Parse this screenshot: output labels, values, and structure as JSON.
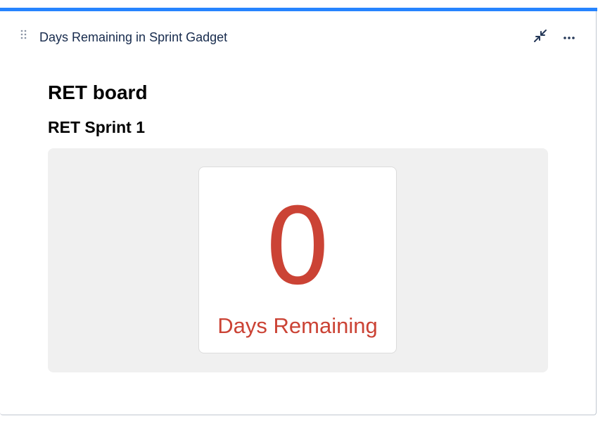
{
  "gadget": {
    "title": "Days Remaining in Sprint Gadget",
    "accent_color": "#2684ff",
    "icons": {
      "drag": "drag-handle-icon",
      "minimize": "minimize-icon",
      "more": "more-options-icon"
    }
  },
  "content": {
    "board_name": "RET board",
    "sprint_name": "RET Sprint 1",
    "days_remaining": "0",
    "days_label": "Days Remaining",
    "highlight_color": "#cb4335"
  }
}
